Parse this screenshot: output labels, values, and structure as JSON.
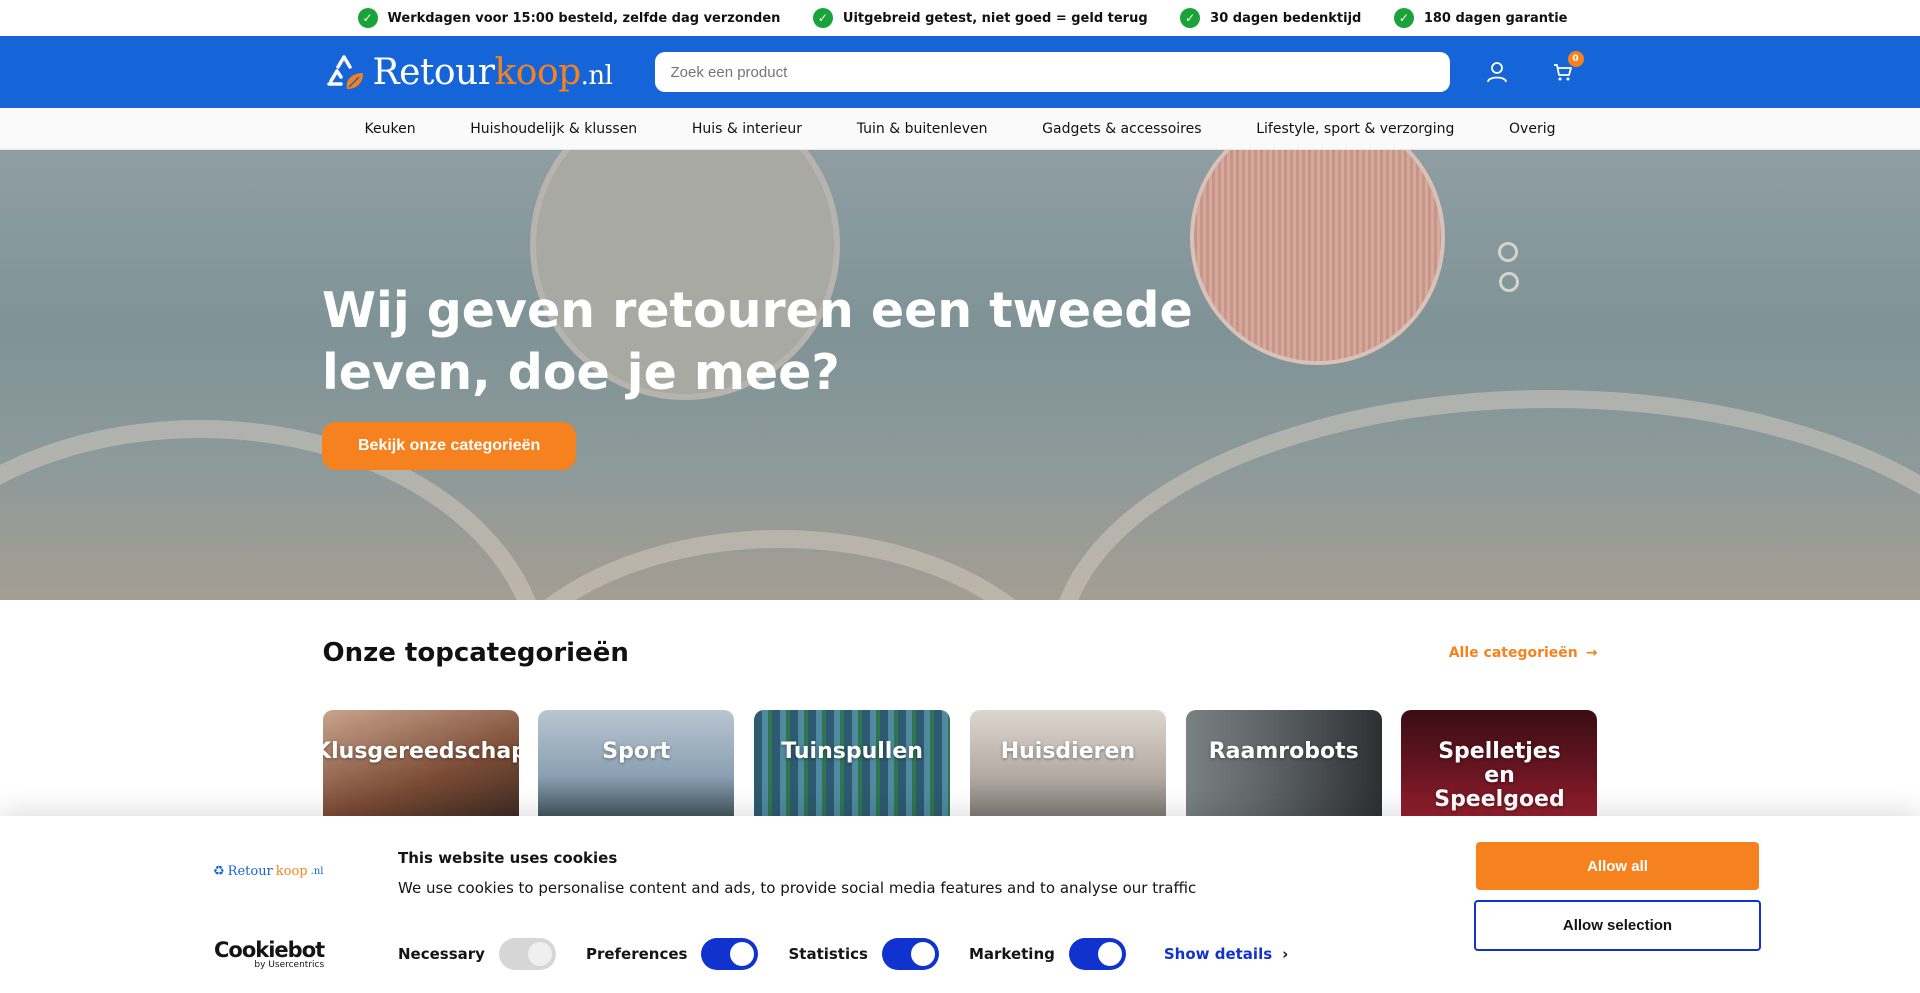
{
  "usp": [
    {
      "text": "Werkdagen voor 15:00 besteld, zelfde dag verzonden"
    },
    {
      "text": "Uitgebreid getest, niet goed = geld terug"
    },
    {
      "text": "30 dagen bedenktijd"
    },
    {
      "text": "180 dagen garantie"
    }
  ],
  "header": {
    "logo_main": "Retour",
    "logo_accent": "koop",
    "logo_tld": ".nl",
    "search_placeholder": "Zoek een product",
    "cart_count": "0"
  },
  "nav": [
    "Keuken",
    "Huishoudelijk & klussen",
    "Huis & interieur",
    "Tuin & buitenleven",
    "Gadgets & accessoires",
    "Lifestyle, sport & verzorging",
    "Overig"
  ],
  "hero": {
    "title": "Wij geven retouren een tweede leven, doe je mee?",
    "button": "Bekijk onze categorieën"
  },
  "categories": {
    "title": "Onze topcategorieën",
    "all_link": "Alle categorieën",
    "items": [
      {
        "label": "Klusgereedschap",
        "color": "#7a4a35"
      },
      {
        "label": "Sport",
        "color": "#8aa0b3"
      },
      {
        "label": "Tuinspullen",
        "color": "#3d6b80"
      },
      {
        "label": "Huisdieren",
        "color": "#b3aaa3"
      },
      {
        "label": "Raamrobots",
        "color": "#5f6566"
      },
      {
        "label": "Spelletjes en Speelgoed",
        "color": "#6b1622"
      }
    ]
  },
  "cookie": {
    "logo_main": "Retour",
    "logo_accent": "koop",
    "logo_tld": ".nl",
    "title": "This website uses cookies",
    "text": "We use cookies to personalise content and ads, to provide social media features and to analyse our traffic",
    "toggles": [
      {
        "label": "Necessary",
        "on": false
      },
      {
        "label": "Preferences",
        "on": true
      },
      {
        "label": "Statistics",
        "on": true
      },
      {
        "label": "Marketing",
        "on": true
      }
    ],
    "details": "Show details",
    "allow_all": "Allow all",
    "allow_selection": "Allow selection",
    "brand": "Cookiebot",
    "brand_sub": "by Usercentrics"
  },
  "colors": {
    "brand_blue": "#1565d8",
    "accent_orange": "#f5821f",
    "cookie_blue": "#1032cf"
  }
}
